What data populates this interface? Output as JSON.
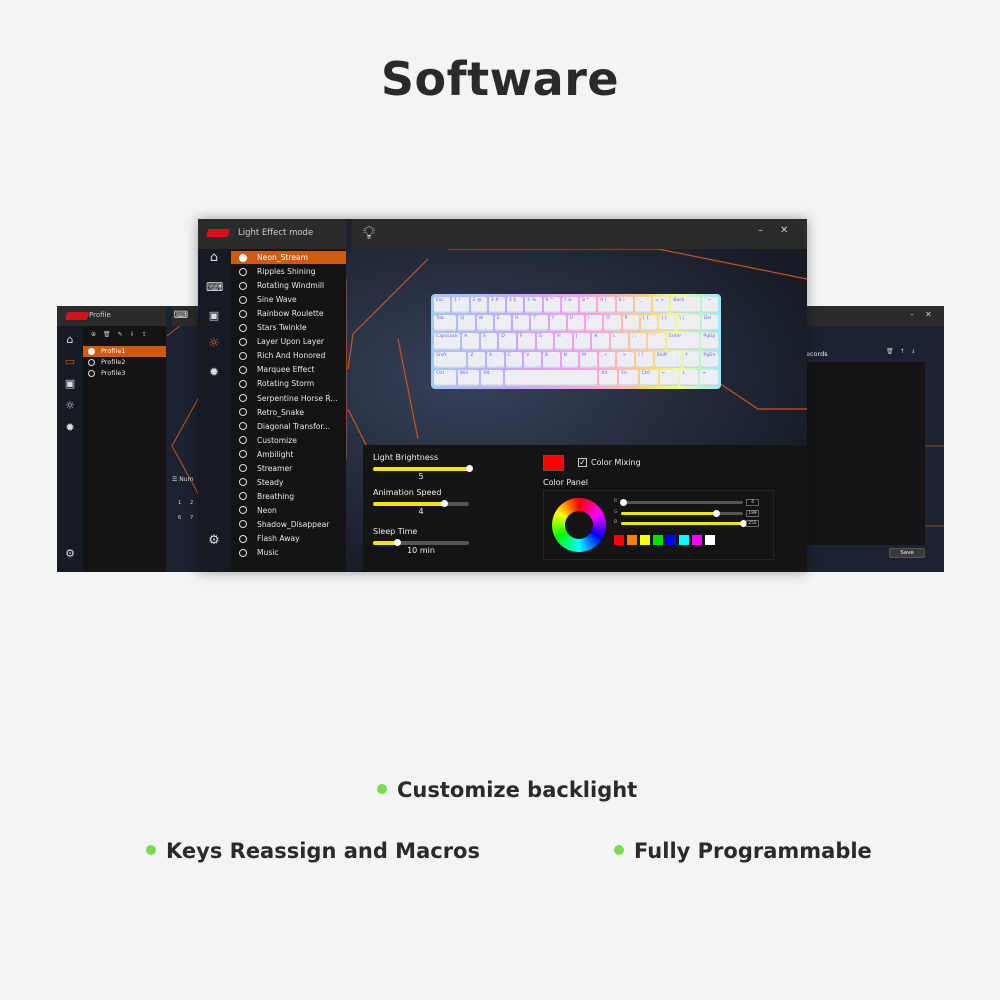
{
  "page_title": "Software",
  "main_window": {
    "title": "Light Effect mode",
    "active_tab_icon": "lightbulb-icon",
    "controls": {
      "minimize": "–",
      "close": "✕"
    },
    "sidebar_icons": [
      "home-icon",
      "keyboard-icon",
      "terminal-icon",
      "lightbulb-icon",
      "gear-chip-icon"
    ],
    "settings_icon": "settings-icon",
    "effects": [
      "Neon_Stream",
      "Ripples Shining",
      "Rotating Windmill",
      "Sine Wave",
      "Rainbow Roulette",
      "Stars Twinkle",
      "Layer Upon Layer",
      "Rich And Honored",
      "Marquee Effect",
      "Rotating Storm",
      "Serpentine Horse R...",
      "Retro_Snake",
      "Diagonal Transfor...",
      "Customize",
      "Ambilight",
      "Streamer",
      "Steady",
      "Breathing",
      "Neon",
      "Shadow_Disappear",
      "Flash Away",
      "Music"
    ],
    "selected_effect": "Neon_Stream",
    "settings": {
      "brightness": {
        "label": "Light Brightness",
        "value": "5",
        "level": 1.0
      },
      "speed": {
        "label": "Animation Speed",
        "value": "4",
        "level": 0.74
      },
      "sleep": {
        "label": "Sleep Time",
        "value": "10 min",
        "level": 0.26
      }
    },
    "color": {
      "current": "#ff0000",
      "mixing_label": "Color Mixing",
      "mixing_checked": true,
      "panel_label": "Color Panel",
      "rgb": [
        {
          "channel": "R",
          "value": "4",
          "level": 0.02
        },
        {
          "channel": "G",
          "value": "199",
          "level": 0.78
        },
        {
          "channel": "B",
          "value": "255",
          "level": 1.0
        }
      ],
      "presets": [
        "#ff0000",
        "#ff8000",
        "#ffff00",
        "#00e000",
        "#0000ff",
        "#00ffff",
        "#ff00ff",
        "#ffffff"
      ]
    },
    "keyboard_rows": [
      [
        [
          "Esc",
          1
        ],
        [
          "1 !",
          1
        ],
        [
          "2 @",
          1
        ],
        [
          "3 #",
          1
        ],
        [
          "4 $",
          1
        ],
        [
          "5 %",
          1
        ],
        [
          "6 ^",
          1
        ],
        [
          "7 &",
          1
        ],
        [
          "8 *",
          1
        ],
        [
          "9 (",
          1
        ],
        [
          "0 )",
          1
        ],
        [
          "- _",
          1
        ],
        [
          "= +",
          1
        ],
        [
          "Back",
          2
        ],
        [
          "` ~",
          1
        ]
      ],
      [
        [
          "Tab",
          1.5
        ],
        [
          "Q",
          1
        ],
        [
          "W",
          1
        ],
        [
          "E",
          1
        ],
        [
          "R",
          1
        ],
        [
          "T",
          1
        ],
        [
          "Y",
          1
        ],
        [
          "U",
          1
        ],
        [
          "I",
          1
        ],
        [
          "O",
          1
        ],
        [
          "P",
          1
        ],
        [
          "[ {",
          1
        ],
        [
          "] }",
          1
        ],
        [
          "\\ |",
          1.5
        ],
        [
          "Del",
          1
        ]
      ],
      [
        [
          "CapsLock",
          1.75
        ],
        [
          "A",
          1
        ],
        [
          "S",
          1
        ],
        [
          "D",
          1
        ],
        [
          "F",
          1
        ],
        [
          "G",
          1
        ],
        [
          "H",
          1
        ],
        [
          "J",
          1
        ],
        [
          "K",
          1
        ],
        [
          "L",
          1
        ],
        [
          "; :",
          1
        ],
        [
          "' \"",
          1
        ],
        [
          "Enter",
          2.25
        ],
        [
          "PgUp",
          1
        ]
      ],
      [
        [
          "Shift",
          2.25
        ],
        [
          "Z",
          1
        ],
        [
          "X",
          1
        ],
        [
          "C",
          1
        ],
        [
          "V",
          1
        ],
        [
          "B",
          1
        ],
        [
          "N",
          1
        ],
        [
          "M",
          1
        ],
        [
          ", <",
          1
        ],
        [
          ". >",
          1
        ],
        [
          "/ ?",
          1
        ],
        [
          "Shift",
          1.75
        ],
        [
          "↑",
          1
        ],
        [
          "PgDn",
          1
        ]
      ],
      [
        [
          "Ctrl",
          1.25
        ],
        [
          "Win",
          1.25
        ],
        [
          "Alt",
          1.25
        ],
        [
          "",
          6.25
        ],
        [
          "Alt",
          1
        ],
        [
          "Fn",
          1
        ],
        [
          "Ctrl",
          1
        ],
        [
          "←",
          1
        ],
        [
          "↓",
          1
        ],
        [
          "→",
          1
        ]
      ]
    ]
  },
  "left_window": {
    "title": "Profile",
    "profiles": [
      "Profile1",
      "Profile2",
      "Profile3"
    ],
    "selected_profile": "Profile1",
    "toolbar_icons": [
      "add-icon",
      "trash-icon",
      "edit-icon",
      "import-icon",
      "export-icon"
    ],
    "num_label": "Num",
    "numbers": [
      "1",
      "2",
      "6",
      "7"
    ]
  },
  "right_window": {
    "records_title": "Macro Records",
    "save_label": "Save",
    "controls": {
      "minimize": "–",
      "close": "✕"
    }
  },
  "features": {
    "backlight": "Customize backlight",
    "macros": "Keys Reassign and Macros",
    "programmable": "Fully Programmable"
  },
  "colors": {
    "accent": "#d05a0e",
    "slider": "#f2e600",
    "bullet": "#77dd4a"
  }
}
